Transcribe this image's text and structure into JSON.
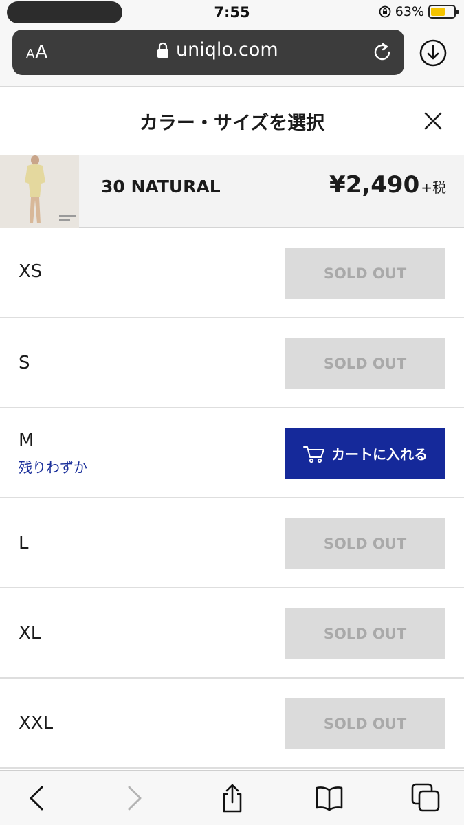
{
  "status_bar": {
    "time": "7:55",
    "battery_percent": "63%",
    "battery_level": 0.63,
    "battery_color": "#f5c400"
  },
  "browser": {
    "text_size_label": "AA",
    "url": "uniqlo.com"
  },
  "sheet": {
    "title": "カラー・サイズを選択"
  },
  "product": {
    "color_name": "30 NATURAL",
    "price": "¥2,490",
    "tax_suffix": "+税"
  },
  "sizes": [
    {
      "size": "XS",
      "status": "SOLD OUT"
    },
    {
      "size": "S",
      "status": "SOLD OUT"
    },
    {
      "size": "M",
      "note": "残りわずか",
      "action": "カートに入れる"
    },
    {
      "size": "L",
      "status": "SOLD OUT"
    },
    {
      "size": "XL",
      "status": "SOLD OUT"
    },
    {
      "size": "XXL",
      "status": "SOLD OUT"
    }
  ],
  "colors": {
    "accent": "#15299a",
    "stock_note": "#1a2f9a",
    "sold_out_bg": "#dbdbdb",
    "sold_out_text": "#a9a9a9"
  },
  "toolbar_icons": [
    "back-icon",
    "forward-icon",
    "share-icon",
    "bookmarks-icon",
    "tabs-icon"
  ]
}
